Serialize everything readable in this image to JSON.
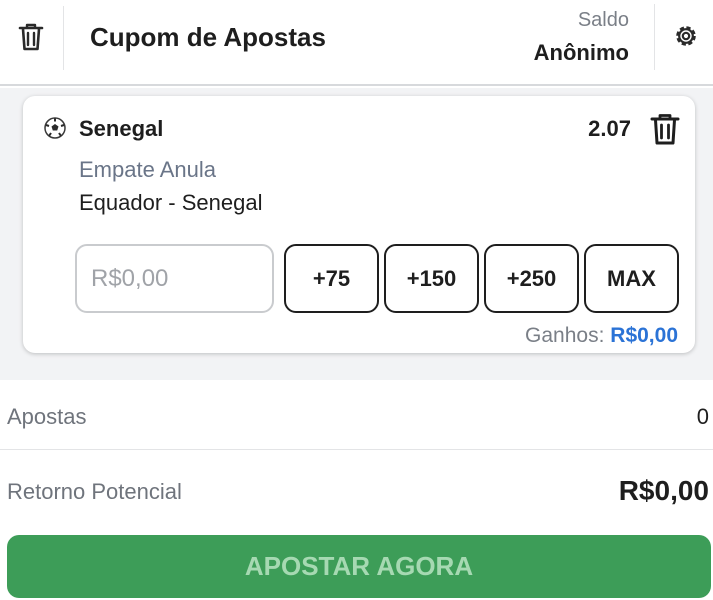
{
  "header": {
    "title": "Cupom de Apostas",
    "saldo_label": "Saldo",
    "saldo_value": "Anônimo"
  },
  "bet": {
    "team": "Senegal",
    "odds": "2.07",
    "market": "Empate Anula",
    "match": "Equador - Senegal",
    "stake_placeholder": "R$0,00",
    "quick_amounts": [
      "+75",
      "+150",
      "+250",
      "MAX"
    ],
    "winnings_label": "Ganhos:",
    "winnings_value": "R$0,00"
  },
  "summary": {
    "bets_label": "Apostas",
    "bets_count": "0",
    "return_label": "Retorno Potencial",
    "return_value": "R$0,00"
  },
  "actions": {
    "place_bet": "APOSTAR AGORA"
  },
  "colors": {
    "accent_green": "#3d9d58",
    "link_blue": "#2b73d6"
  }
}
